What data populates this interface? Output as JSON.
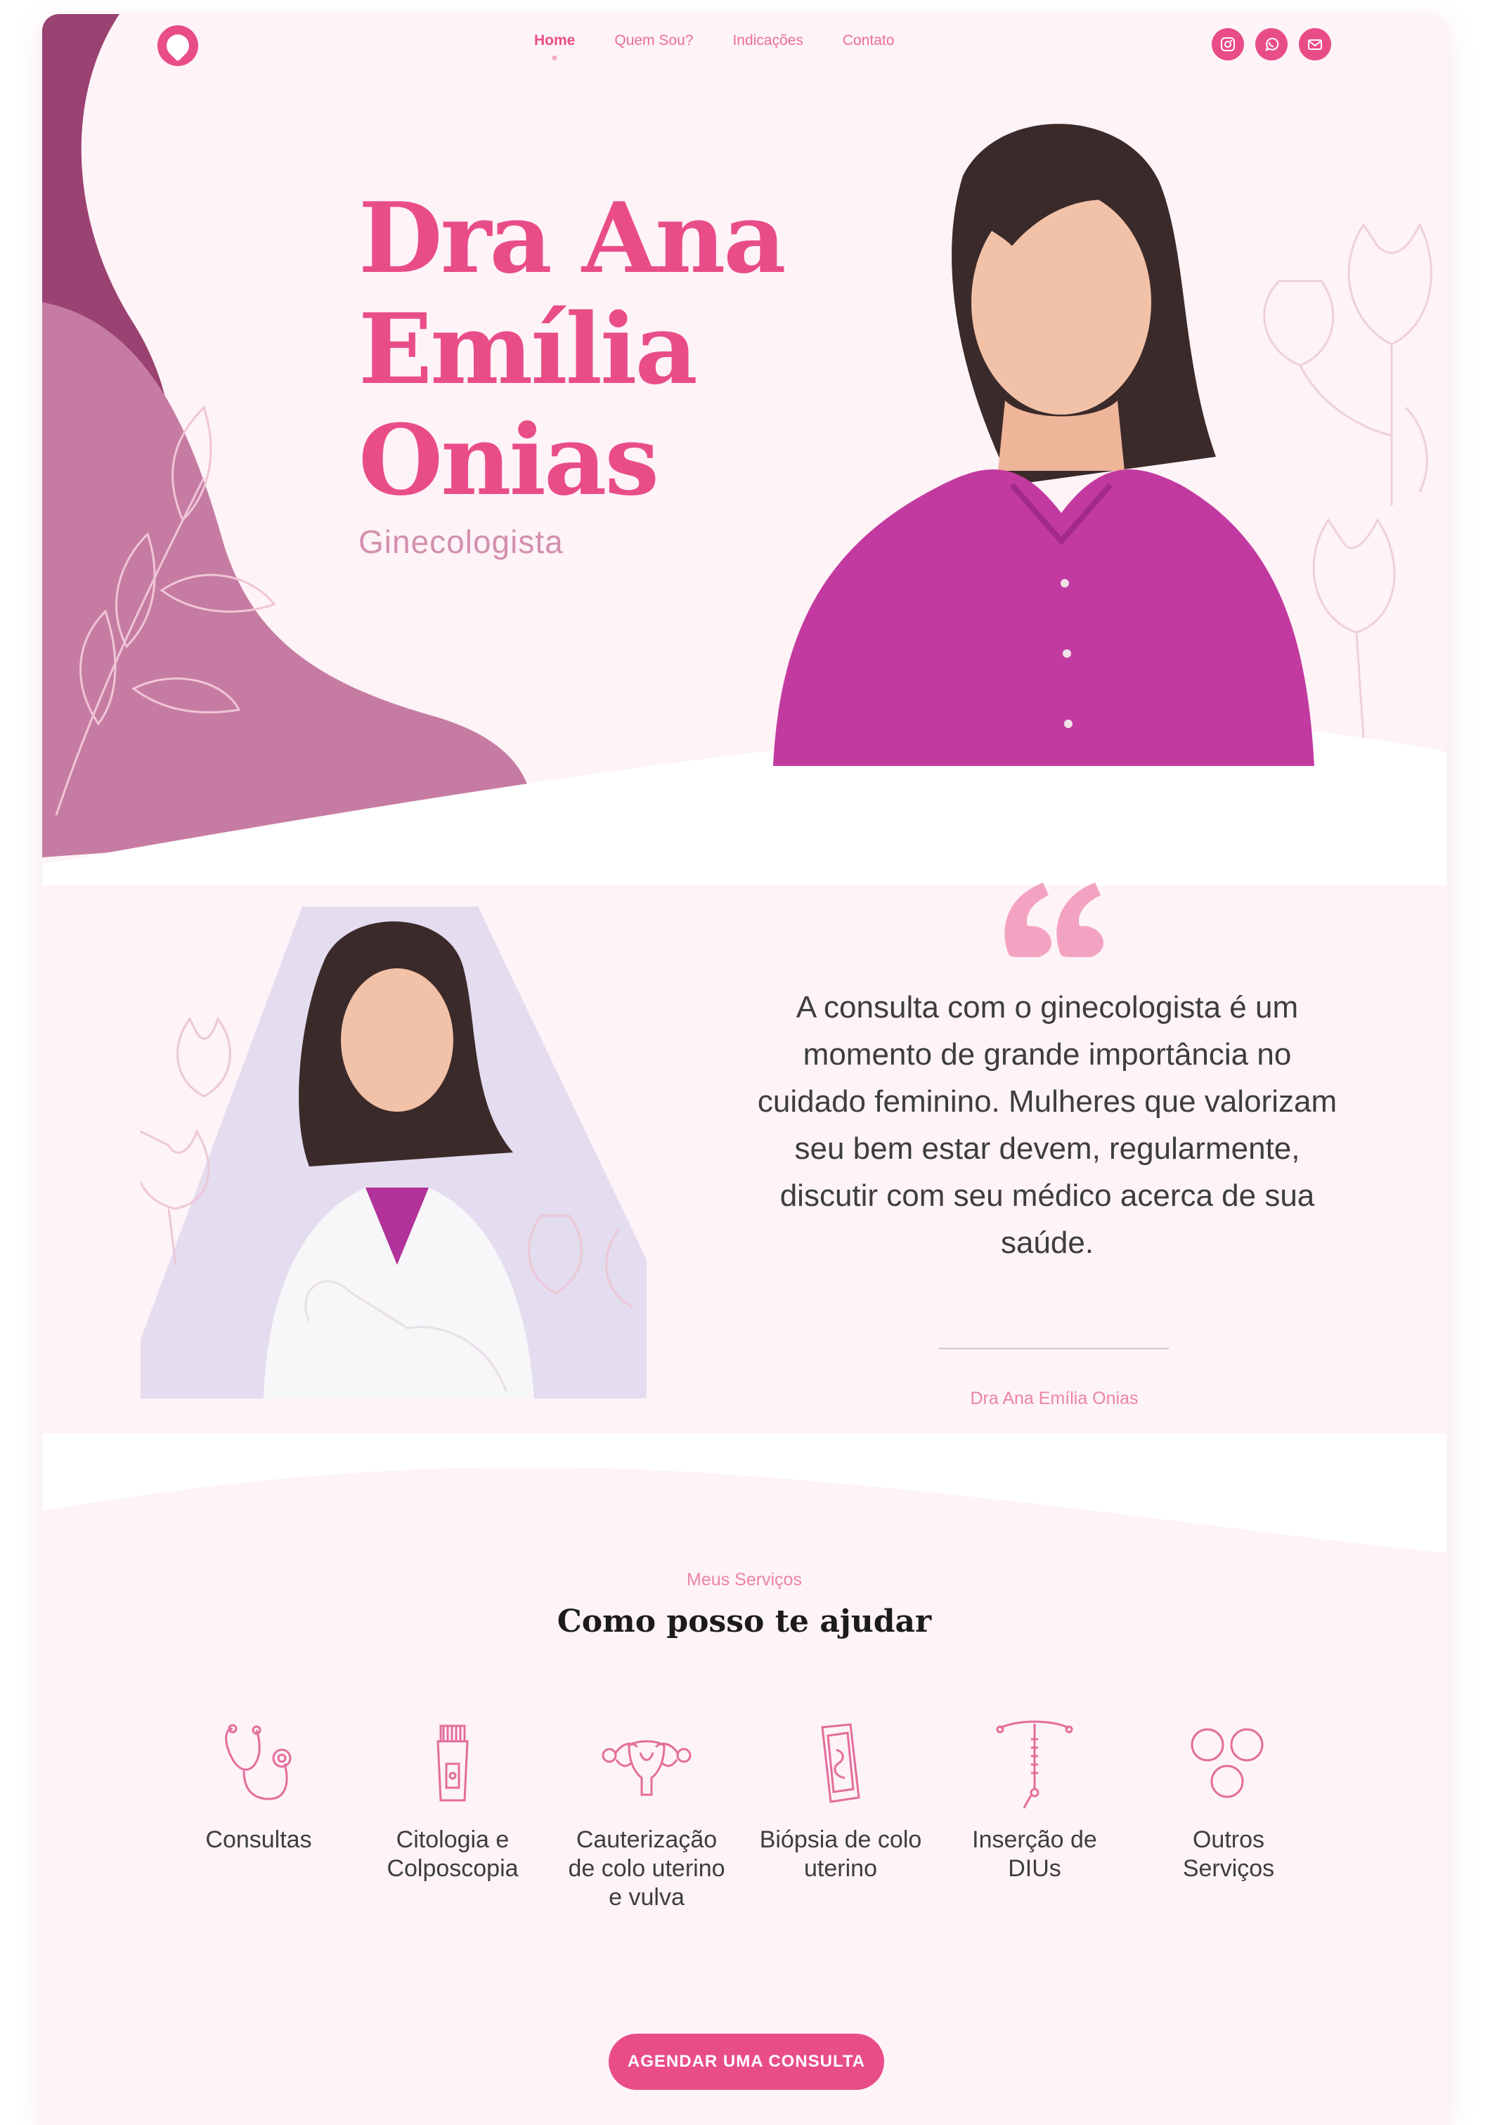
{
  "nav": {
    "links": [
      {
        "label": "Home",
        "active": true
      },
      {
        "label": "Quem Sou?",
        "active": false
      },
      {
        "label": "Indicações",
        "active": false
      },
      {
        "label": "Contato",
        "active": false
      }
    ],
    "social_icons": [
      "instagram-icon",
      "whatsapp-icon",
      "mail-icon"
    ]
  },
  "hero": {
    "name_lines": [
      "Dra Ana",
      "Emília",
      "Onias"
    ],
    "role": "Ginecologista"
  },
  "quote": {
    "text": "A consulta com o ginecologista é um momento de grande importância no cuidado feminino. Mulheres que valorizam seu bem estar devem, regularmente, discutir com seu médico acerca de sua saúde.",
    "author": "Dra Ana Emília Onias"
  },
  "services": {
    "kicker": "Meus Serviços",
    "title": "Como posso te ajudar",
    "items": [
      {
        "label": "Consultas",
        "icon": "stethoscope-icon"
      },
      {
        "label": "Citologia e Colposcopia",
        "icon": "test-tube-icon"
      },
      {
        "label": "Cauterização de colo uterino e vulva",
        "icon": "uterus-icon"
      },
      {
        "label": "Biópsia de colo uterino",
        "icon": "biopsy-slide-icon"
      },
      {
        "label": "Inserção de DIUs",
        "icon": "iud-icon"
      },
      {
        "label": "Outros Serviços",
        "icon": "circles-icon"
      }
    ]
  },
  "cta": {
    "label": "AGENDAR UMA CONSULTA"
  },
  "colors": {
    "primary": "#e94d88",
    "background": "#fef3f7",
    "mauve": "#c67ca2",
    "dark_mauve": "#9a4272",
    "line_art": "#eba5c0"
  }
}
